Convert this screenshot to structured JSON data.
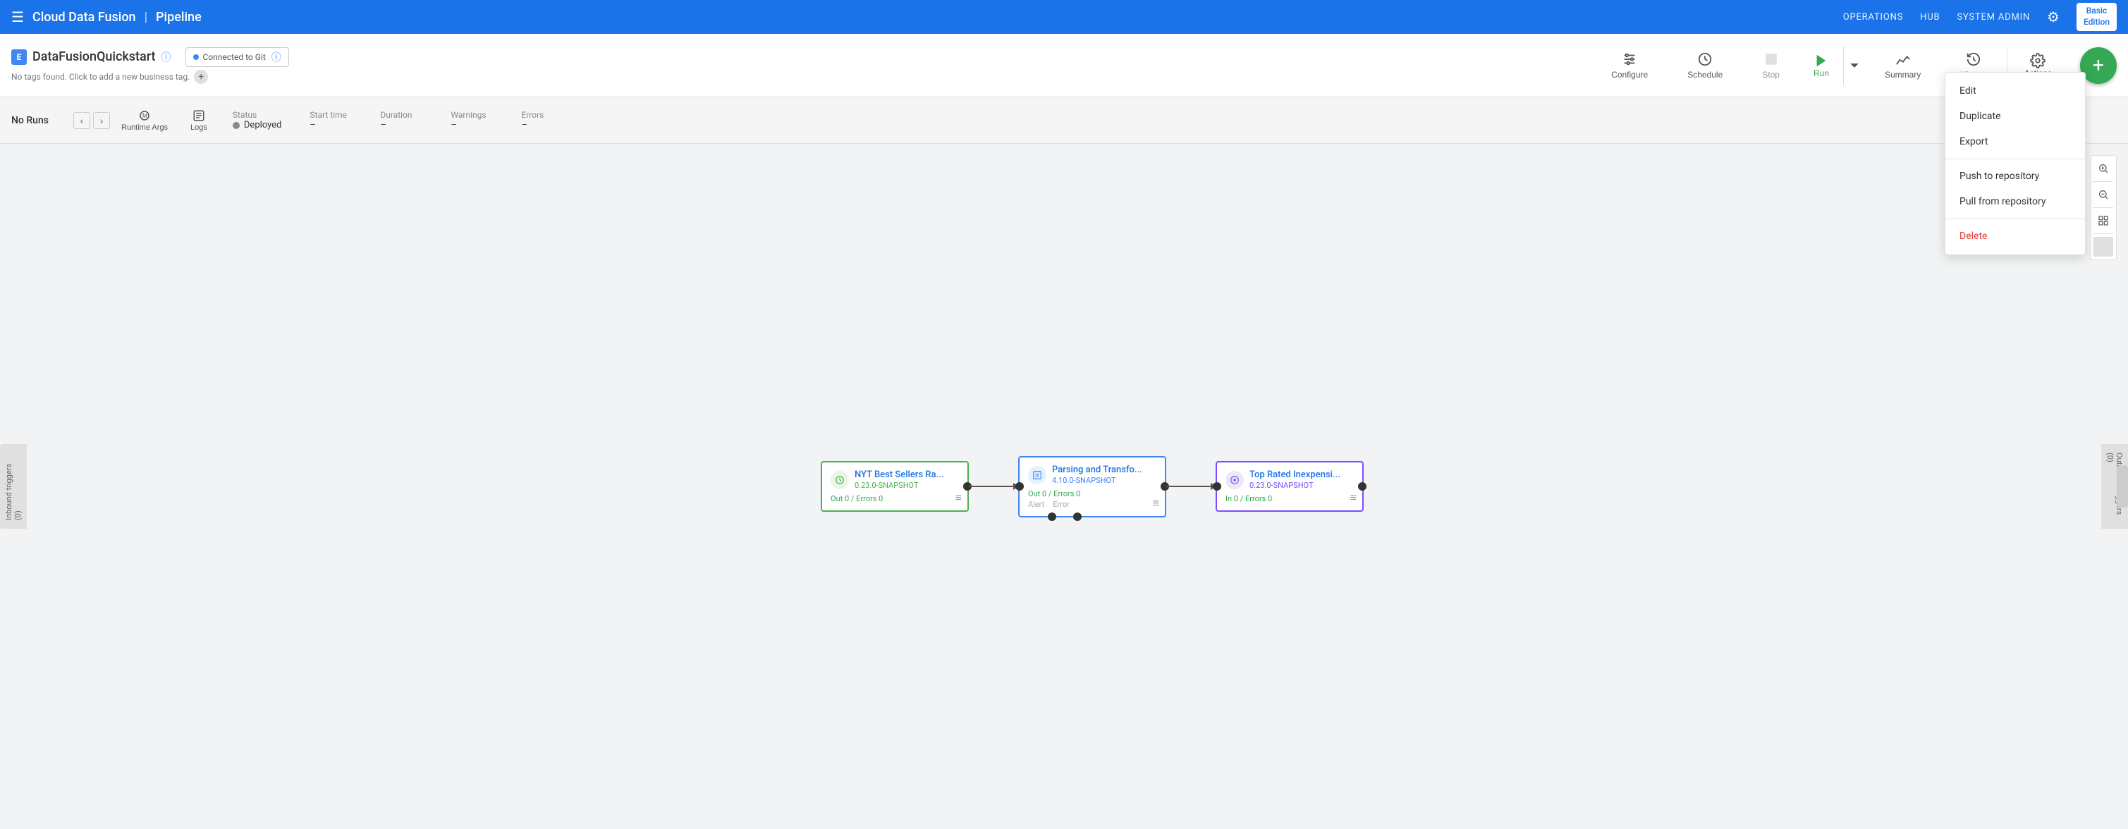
{
  "topNav": {
    "hamburger": "☰",
    "appName": "Cloud Data Fusion",
    "divider": "|",
    "subTitle": "Pipeline",
    "navLinks": [
      "OPERATIONS",
      "HUB",
      "SYSTEM ADMIN"
    ],
    "gearIcon": "⚙",
    "edition": "Basic\nEdition"
  },
  "pipelineHeader": {
    "pipelineName": "DataFusionQuickstart",
    "gitBadge": "Connected to Git",
    "tagsText": "No tags found. Click to add a new business tag.",
    "toolbar": {
      "configure": "Configure",
      "schedule": "Schedule",
      "stop": "Stop",
      "run": "Run",
      "summary": "Summary",
      "history": "History",
      "actions": "Actions"
    }
  },
  "runStatusBar": {
    "noRuns": "No Runs",
    "runtimeArgs": "Runtime Args",
    "logs": "Logs",
    "status": {
      "label": "Status",
      "value": "Deployed"
    },
    "startTime": {
      "label": "Start time",
      "value": "–"
    },
    "duration": {
      "label": "Duration",
      "value": "–"
    },
    "warnings": {
      "label": "Warnings",
      "value": "–"
    },
    "errors": {
      "label": "Errors",
      "value": "–"
    }
  },
  "triggers": {
    "inbound": "Inbound triggers (0)",
    "outbound": "Outbound triggers (0)"
  },
  "nodes": [
    {
      "id": "source",
      "title": "NYT Best Sellers Ra...",
      "version": "0.23.0-SNAPSHOT",
      "metrics": "Out 0 / Errors 0",
      "type": "source",
      "borderColor": "#4caf50",
      "versionColor": "green"
    },
    {
      "id": "transform",
      "title": "Parsing and Transfo...",
      "version": "4.10.0-SNAPSHOT",
      "metrics": "Out 0 / Errors 0",
      "alerts": [
        "Alert",
        "Error"
      ],
      "type": "transform",
      "borderColor": "#4285f4",
      "versionColor": "blue"
    },
    {
      "id": "sink",
      "title": "Top Rated Inexpensi...",
      "version": "0.23.0-SNAPSHOT",
      "metrics": "In 0 / Errors 0",
      "type": "sink",
      "borderColor": "#7c4dff",
      "versionColor": "purple"
    }
  ],
  "actionsDropdown": {
    "items": [
      "Edit",
      "Duplicate",
      "Export"
    ],
    "dividerAfter": 2,
    "repoItems": [
      "Push to repository",
      "Pull from repository"
    ],
    "deleteItem": "Delete"
  }
}
